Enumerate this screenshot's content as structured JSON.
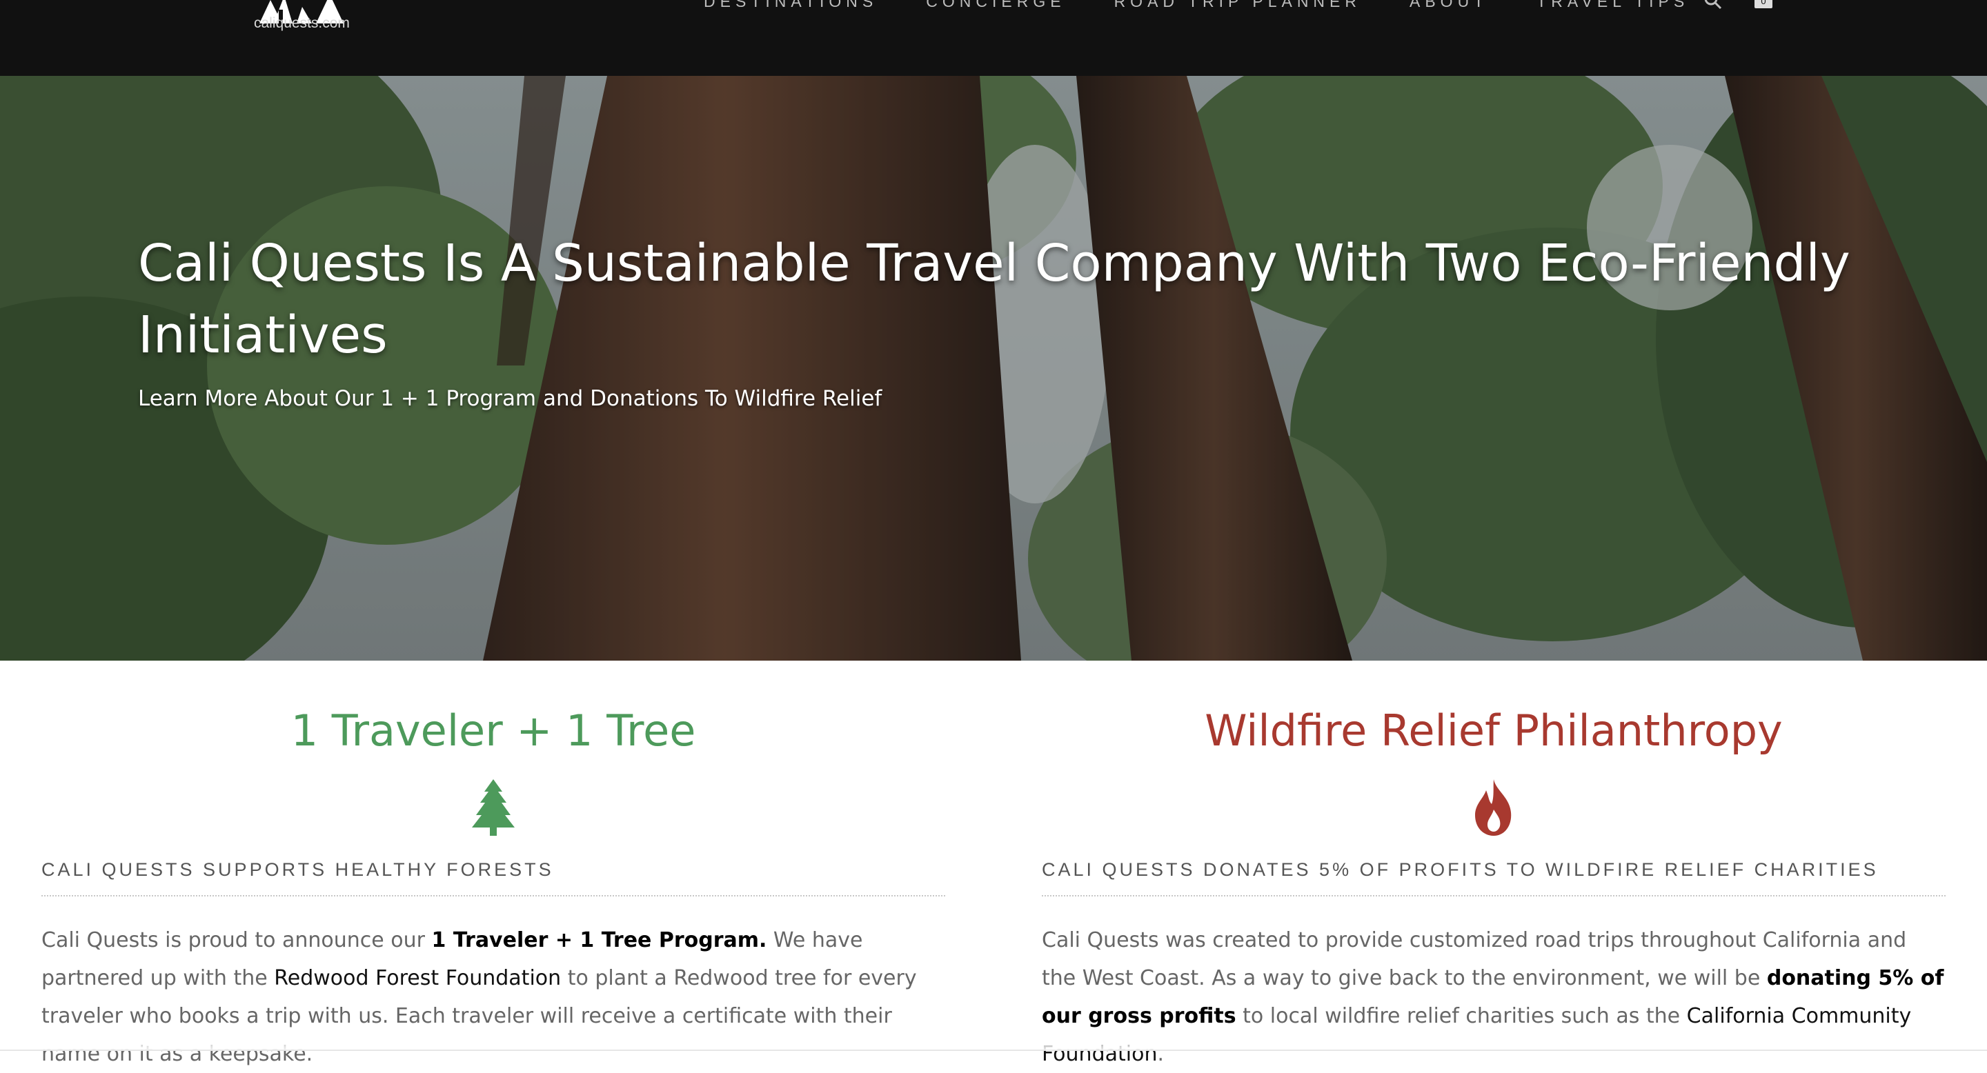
{
  "header": {
    "logo_text": "caliquests.com",
    "nav": [
      "Destinations",
      "Concierge",
      "Road Trip Planner",
      "About",
      "Travel Tips"
    ],
    "cart_count": "0",
    "icons": {
      "search": "search-icon",
      "cart": "cart-icon",
      "logo": "logo-mark-icon"
    }
  },
  "hero": {
    "title": "Cali Quests Is A Sustainable Travel Company With Two Eco-Friendly Initiatives",
    "subtitle": "Learn More About Our 1 + 1 Program and Donations To Wildfire Relief"
  },
  "left": {
    "title": "1 Traveler + 1 Tree",
    "icon": "tree-icon",
    "subheading": "Cali Quests Supports Healthy Forests",
    "body": {
      "p1": "Cali Quests is proud to announce our ",
      "b1": "1 Traveler + 1 Tree Program.",
      "p2": " We have partnered up with the ",
      "link": "Redwood Forest Foundation",
      "p3": " to plant a Redwood tree for every traveler who books a trip with us. Each traveler will receive a certificate with their name on it as a keepsake."
    }
  },
  "right": {
    "title": "Wildfire Relief Philanthropy",
    "icon": "flame-icon",
    "subheading": "Cali Quests Donates 5% Of Profits To Wildfire Relief Charities",
    "body": {
      "p1": "Cali Quests was created to provide customized road trips throughout California and the West Coast. As a way to give back to the environment, we will be ",
      "b1": "donating 5% of our gross profits",
      "p2": " to local wildfire relief charities such as the ",
      "link": "California Community Foundation",
      "p3": "."
    }
  },
  "colors": {
    "nav_bg": "#111111",
    "green_accent": "#4d9a5b",
    "red_accent": "#a8392f",
    "body_text": "#666666"
  }
}
